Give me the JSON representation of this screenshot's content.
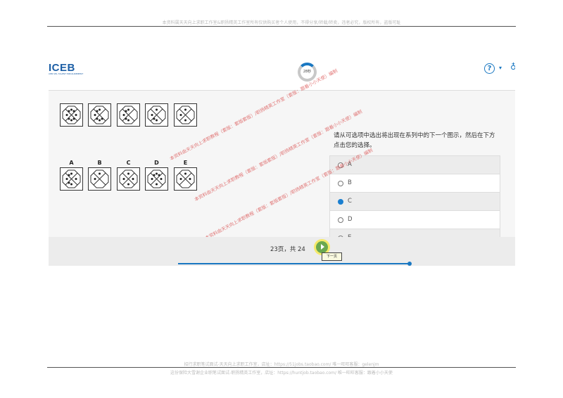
{
  "page": {
    "header_note": "本资料属天天向上求职工作室&职扬精英工作室所有仅供购买者个人使用，不得分享/转载/转卖，违者必究，版权所有，盗版可耻",
    "footer_note_1": "招行求职笔试面试-天天向上求职工作室，店址：https://51jobs.taobao.com/ 唯一旺旺客服：gelenjm",
    "footer_note_2": "这份保险大雪谢企业职笔试面试-职扬精英工作室，店址：https://huntjob.taobao.com/ 唯一旺旺客服：跟着小小天使"
  },
  "app": {
    "logo": "ICEB",
    "logo_sub": "CEB SHL TALENT MEASUREMENT",
    "timer": "28秒",
    "help_icon": "question-circle-icon",
    "user_icon": "user-icon"
  },
  "question": {
    "text": "请从可选项中选出将出现在系列中的下一个图示，然后在下方点击您的选择。",
    "series_count": 5,
    "answer_labels": [
      "A",
      "B",
      "C",
      "D",
      "E"
    ],
    "options": [
      {
        "label": "A",
        "selected": false
      },
      {
        "label": "B",
        "selected": false
      },
      {
        "label": "C",
        "selected": true
      },
      {
        "label": "D",
        "selected": false
      },
      {
        "label": "E",
        "selected": false
      }
    ],
    "watermark": "本资料由天天向上求职教程（套版：套版套版）/职扬精英工作室（套版：跟着小小天使）编制"
  },
  "footer": {
    "pager": "23页，共 24",
    "next_tooltip": "下一页",
    "progress": 0.96
  },
  "colors": {
    "accent": "#1a78c2",
    "selected": "#1a7fd0",
    "next": "#6aa84f"
  }
}
